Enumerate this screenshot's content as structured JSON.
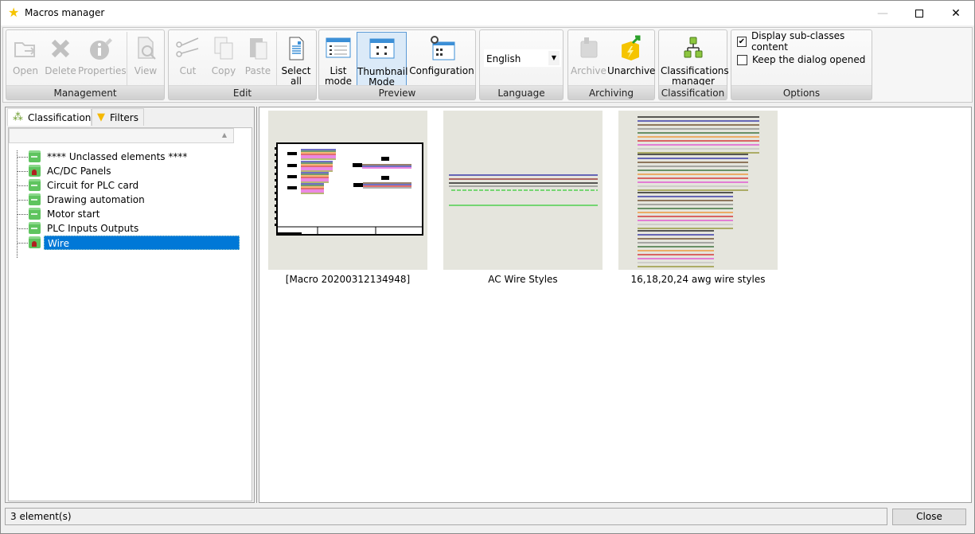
{
  "window": {
    "title": "Macros manager",
    "icon": "star-icon",
    "controls": [
      "minimize",
      "maximize",
      "close"
    ]
  },
  "ribbon": {
    "groups": [
      {
        "label": "Management",
        "buttons": [
          {
            "label": "Open",
            "icon": "open-folder-icon",
            "enabled": false
          },
          {
            "label": "Delete",
            "icon": "delete-x-icon",
            "enabled": false
          },
          {
            "label": "Properties",
            "icon": "properties-info-icon",
            "enabled": false
          },
          {
            "label": "View",
            "icon": "view-magnifier-icon",
            "enabled": false
          }
        ]
      },
      {
        "label": "Edit",
        "buttons": [
          {
            "label": "Cut",
            "icon": "scissors-icon",
            "enabled": false
          },
          {
            "label": "Copy",
            "icon": "copy-icon",
            "enabled": false
          },
          {
            "label": "Paste",
            "icon": "paste-icon",
            "enabled": false
          },
          {
            "label": "Select\nall",
            "icon": "select-all-icon",
            "enabled": true
          }
        ]
      },
      {
        "label": "Preview",
        "buttons": [
          {
            "label": "List\nmode",
            "icon": "list-mode-icon",
            "enabled": true
          },
          {
            "label": "Thumbnail\nMode",
            "icon": "thumbnail-mode-icon",
            "enabled": true,
            "active": true
          },
          {
            "label": "Configuration",
            "icon": "configuration-icon",
            "enabled": true
          }
        ]
      },
      {
        "label": "Language",
        "select": {
          "value": "English"
        }
      },
      {
        "label": "Archiving",
        "buttons": [
          {
            "label": "Archive",
            "icon": "archive-icon",
            "enabled": false
          },
          {
            "label": "Unarchive",
            "icon": "unarchive-icon",
            "enabled": true
          }
        ]
      },
      {
        "label": "Classification",
        "buttons": [
          {
            "label": "Classifications\nmanager",
            "icon": "classification-tree-icon",
            "enabled": true
          }
        ]
      },
      {
        "label": "Options",
        "checkboxes": [
          {
            "label": "Display sub-classes content",
            "checked": true
          },
          {
            "label": "Keep the dialog opened",
            "checked": false
          }
        ]
      }
    ]
  },
  "left_panel": {
    "tabs": [
      {
        "label": "Classification",
        "icon": "classification-tree-icon",
        "active": true
      },
      {
        "label": "Filters",
        "icon": "funnel-filter-icon",
        "active": false
      }
    ],
    "tree": [
      {
        "label": "**** Unclassed elements ****",
        "icon": "folder-green-icon",
        "selected": false
      },
      {
        "label": "AC/DC Panels",
        "icon": "folder-user-icon",
        "selected": false
      },
      {
        "label": "Circuit for PLC card",
        "icon": "folder-green-icon",
        "selected": false
      },
      {
        "label": "Drawing automation",
        "icon": "folder-green-icon",
        "selected": false
      },
      {
        "label": "Motor start",
        "icon": "folder-green-icon",
        "selected": false
      },
      {
        "label": "PLC Inputs Outputs",
        "icon": "folder-green-icon",
        "selected": false
      },
      {
        "label": "Wire",
        "icon": "folder-user-icon",
        "selected": true
      }
    ]
  },
  "thumbnails": [
    {
      "caption": "[Macro 20200312134948]"
    },
    {
      "caption": "AC Wire Styles"
    },
    {
      "caption": "16,18,20,24 awg wire styles"
    }
  ],
  "colors": {
    "wires": [
      "#000000",
      "#1a1aa0",
      "#5a3410",
      "#808080",
      "#1e5e1e",
      "#f08a20",
      "#d01818",
      "#e040d0",
      "#c0c0c0",
      "#8a8a20"
    ],
    "selection": "#0078d7",
    "thumb_bg": "#e5e5dd"
  },
  "status": {
    "text": "3 element(s)"
  },
  "footer": {
    "close_label": "Close"
  }
}
